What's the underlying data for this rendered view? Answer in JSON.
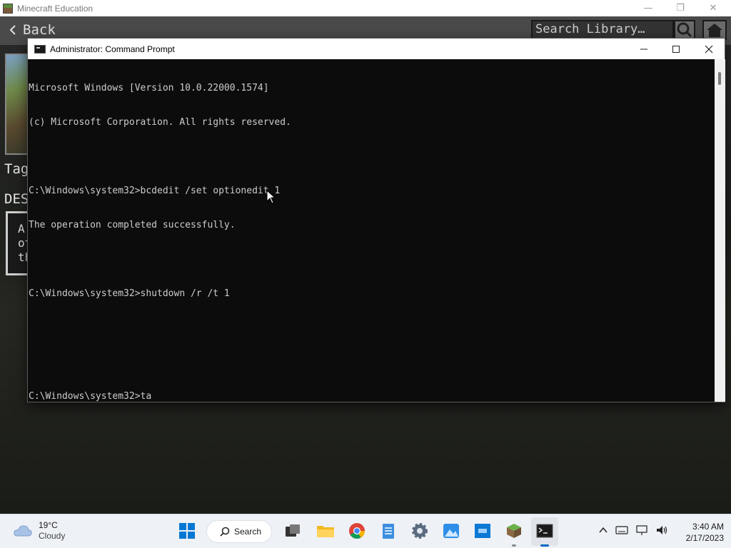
{
  "minecraft": {
    "title": "Minecraft Education",
    "back_label": "Back",
    "search_placeholder": "Search Library…",
    "tags_label": "Tag",
    "description_label": "DES",
    "description_lines": [
      "A",
      "ot",
      "th"
    ]
  },
  "cmd": {
    "title": "Administrator:  Command Prompt",
    "lines": [
      "Microsoft Windows [Version 10.0.22000.1574]",
      "(c) Microsoft Corporation. All rights reserved.",
      "",
      "C:\\Windows\\system32>bcdedit /set optionedit 1",
      "The operation completed successfully.",
      "",
      "C:\\Windows\\system32>shutdown /r /t 1",
      "",
      "",
      "C:\\Windows\\system32>ta"
    ]
  },
  "taskbar": {
    "weather_temp": "19°C",
    "weather_condition": "Cloudy",
    "search_label": "Search",
    "time": "3:40 AM",
    "date": "2/17/2023"
  },
  "icons": {
    "weather": "cloud-icon",
    "start": "windows-start-icon",
    "search": "search-icon",
    "task_view": "task-view-icon",
    "file_explorer": "folder-icon",
    "chrome": "chrome-icon",
    "notepad": "notepad-icon",
    "settings": "gear-icon",
    "photos": "photos-icon",
    "remote": "remote-desktop-icon",
    "minecraft": "minecraft-icon",
    "terminal": "command-prompt-icon"
  },
  "colors": {
    "cmd_background": "#0c0c0c",
    "cmd_text": "#cccccc",
    "taskbar": "#eef1f6",
    "accent": "#0067c0"
  }
}
